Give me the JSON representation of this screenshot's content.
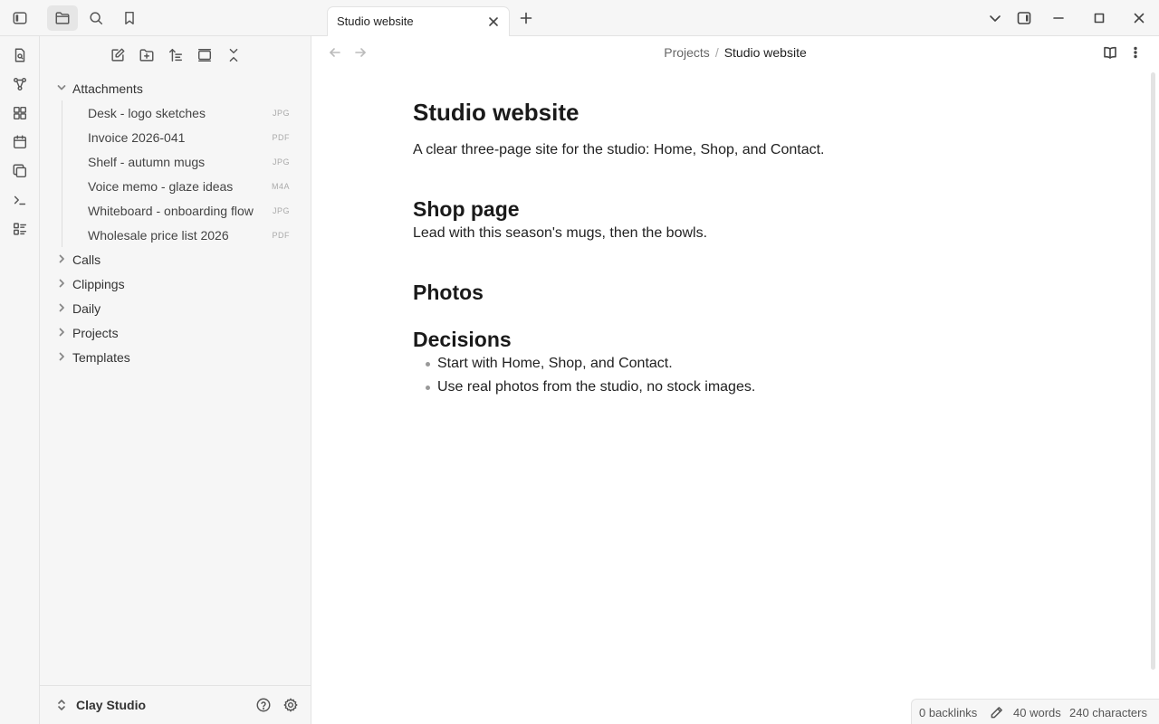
{
  "sidebar": {
    "folders_open": [
      {
        "name": "Attachments"
      }
    ],
    "files": [
      {
        "title": "Desk - logo sketches",
        "ext": "JPG"
      },
      {
        "title": "Invoice 2026-041",
        "ext": "PDF"
      },
      {
        "title": "Shelf - autumn mugs",
        "ext": "JPG"
      },
      {
        "title": "Voice memo - glaze ideas",
        "ext": "M4A"
      },
      {
        "title": "Whiteboard - onboarding flow",
        "ext": "JPG"
      },
      {
        "title": "Wholesale price list 2026",
        "ext": "PDF"
      }
    ],
    "folders_closed": [
      {
        "name": "Calls"
      },
      {
        "name": "Clippings"
      },
      {
        "name": "Daily"
      },
      {
        "name": "Projects"
      },
      {
        "name": "Templates"
      }
    ],
    "vault_name": "Clay Studio"
  },
  "tabs": [
    {
      "label": "Studio website"
    }
  ],
  "breadcrumb": {
    "parent": "Projects",
    "separator": "/",
    "current": "Studio website"
  },
  "note": {
    "title": "Studio website",
    "intro": "A clear three-page site for the studio: Home, Shop, and Contact.",
    "sections": [
      {
        "heading": "Shop page",
        "body": "Lead with this season's mugs, then the bowls."
      },
      {
        "heading": "Photos"
      },
      {
        "heading": "Decisions",
        "bullets": [
          "Start with Home, Shop, and Contact.",
          "Use real photos from the studio, no stock images."
        ]
      }
    ]
  },
  "status": {
    "backlinks": "0 backlinks",
    "words": "40 words",
    "characters": "240 characters"
  },
  "colors": {
    "panel_bg": "#f6f6f6",
    "border": "#e3e3e3",
    "active_btn": "#e6e6e6",
    "text": "#222222"
  }
}
